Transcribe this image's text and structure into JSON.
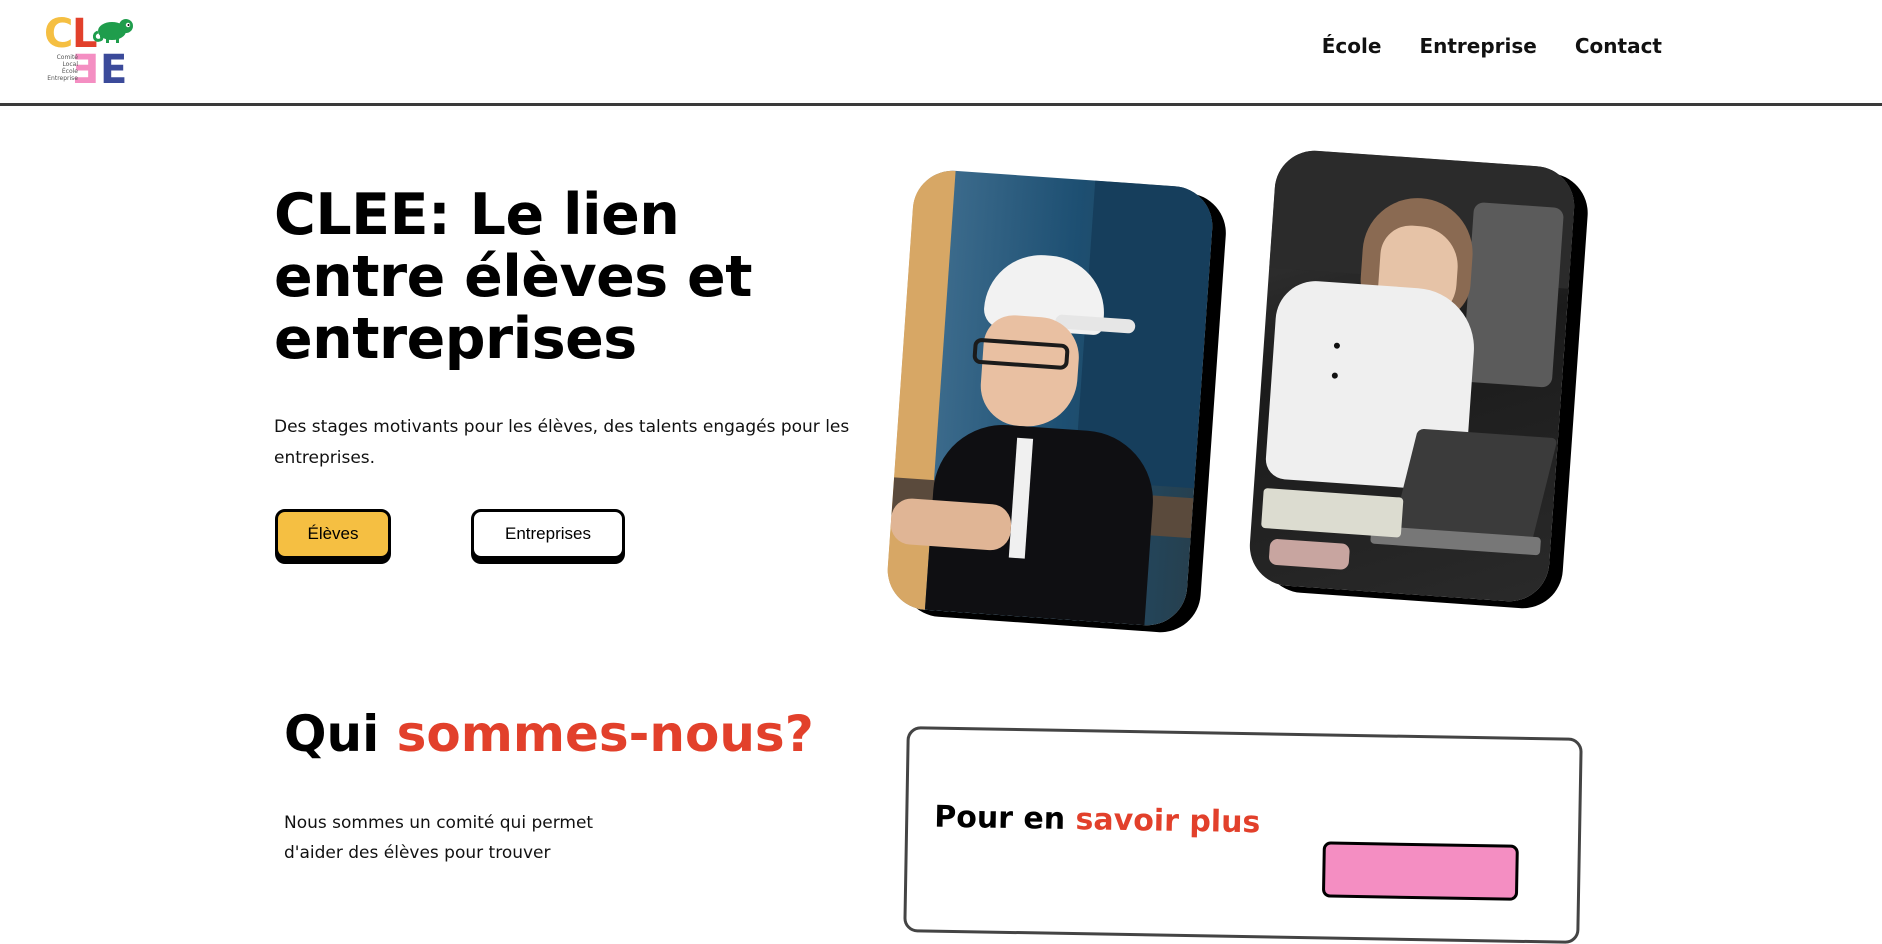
{
  "colors": {
    "brand_yellow": "#f5bf42",
    "brand_red": "#e2402b",
    "brand_green": "#1f9d4c",
    "brand_pink": "#f48ec2",
    "brand_indigo": "#3b4a9a"
  },
  "logo": {
    "letters": {
      "c": "C",
      "l": "L",
      "e1": "E",
      "e2": "E"
    },
    "small_lines": [
      "Comité",
      "Local",
      "École",
      "Entreprise"
    ],
    "icon": "chameleon-icon"
  },
  "nav": {
    "items": [
      "École",
      "Entreprise",
      "Contact"
    ]
  },
  "hero": {
    "title": "CLEE: Le lien entre élèves et entreprises",
    "subtitle": "Des stages motivants pour les élèves, des talents engagés pour les entreprises.",
    "buttons": {
      "eleves": "Élèves",
      "entreprises": "Entreprises"
    },
    "photos": [
      "student-photo",
      "chef-photo"
    ]
  },
  "about": {
    "title_plain": "Qui ",
    "title_accent": "sommes-nous?",
    "text": "Nous sommes un comité qui permet d'aider des élèves pour trouver"
  },
  "card": {
    "title_plain": "Pour en ",
    "title_accent": "savoir plus"
  }
}
